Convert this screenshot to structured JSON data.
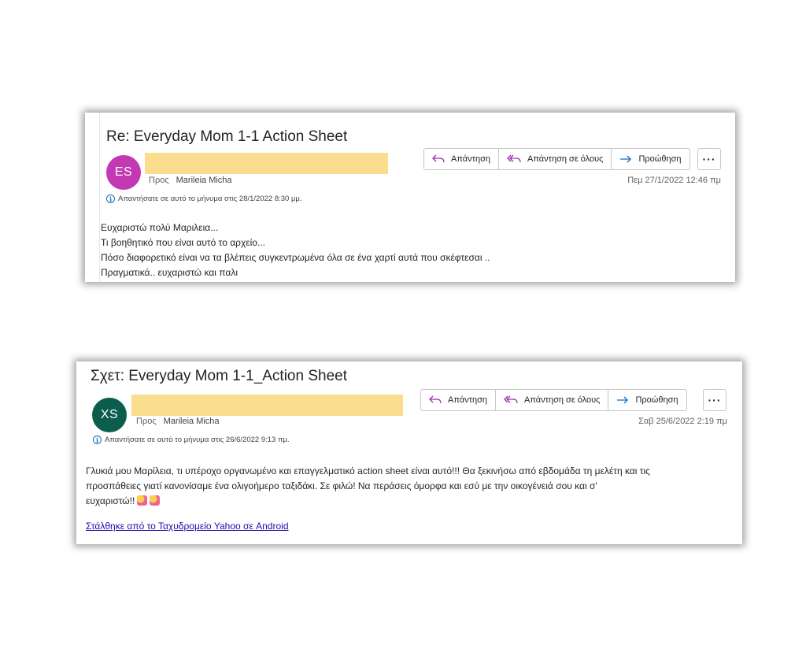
{
  "emails": [
    {
      "subject": "Re: Everyday Mom 1-1 Action Sheet",
      "avatar_initials": "ES",
      "avatar_color": "#c239b3",
      "to_label": "Προς",
      "to_name": "Marileia Micha",
      "info_text": "Απαντήσατε σε αυτό το μήνυμα στις 28/1/2022 8:30 μμ.",
      "buttons": {
        "reply": "Απάντηση",
        "reply_all": "Απάντηση σε όλους",
        "forward": "Προώθηση"
      },
      "more_label": "···",
      "date": "Πεμ 27/1/2022 12:46 πμ",
      "body_lines": [
        "Ευχαριστώ πολύ Μαριλεια...",
        "Τι βοηθητικό που είναι αυτό το αρχείο...",
        "Πόσο διαφορετικό είναι να τα βλέπεις συγκεντρωμένα όλα σε ένα χαρτί αυτά που σκέφτεσαι ..",
        "Πραγματικά.. ευχαριστώ και παλι"
      ]
    },
    {
      "subject": "Σχετ: Everyday Mom 1-1_Action Sheet",
      "avatar_initials": "XS",
      "avatar_color": "#0b5d4e",
      "to_label": "Προς",
      "to_name": "Marileia Micha",
      "info_text": "Απαντήσατε σε αυτό το μήνυμα στις 26/6/2022 9:13 πμ.",
      "buttons": {
        "reply": "Απάντηση",
        "reply_all": "Απάντηση σε όλους",
        "forward": "Προώθηση"
      },
      "more_label": "···",
      "date": "Σαβ 25/6/2022 2:19 πμ",
      "body_line_1": "Γλυκιά μου Μαρίλεια, τι υπέροχο οργανωμένο και επαγγελματικό action sheet είναι αυτό!!! Θα ξεκινήσω από εβδομάδα τη μελέτη και τις",
      "body_line_2": "προσπάθειες γιατί κανονίσαμε ένα ολιγοήμερο ταξιδάκι. Σε φιλώ! Να περάσεις όμορφα και εσύ με την οικογένειά σου και σ'",
      "body_line_3": "ευχαριστώ!!",
      "emoji": [
        "heart-face-emoji",
        "heart-face-emoji"
      ],
      "link_text": "Στάλθηκε από το Ταχυδρομείο Yahoo σε Android"
    }
  ],
  "colors": {
    "redaction": "#fbdd8f",
    "accent": "#0f6cbd",
    "reply_icon": "#9c2fb0"
  }
}
